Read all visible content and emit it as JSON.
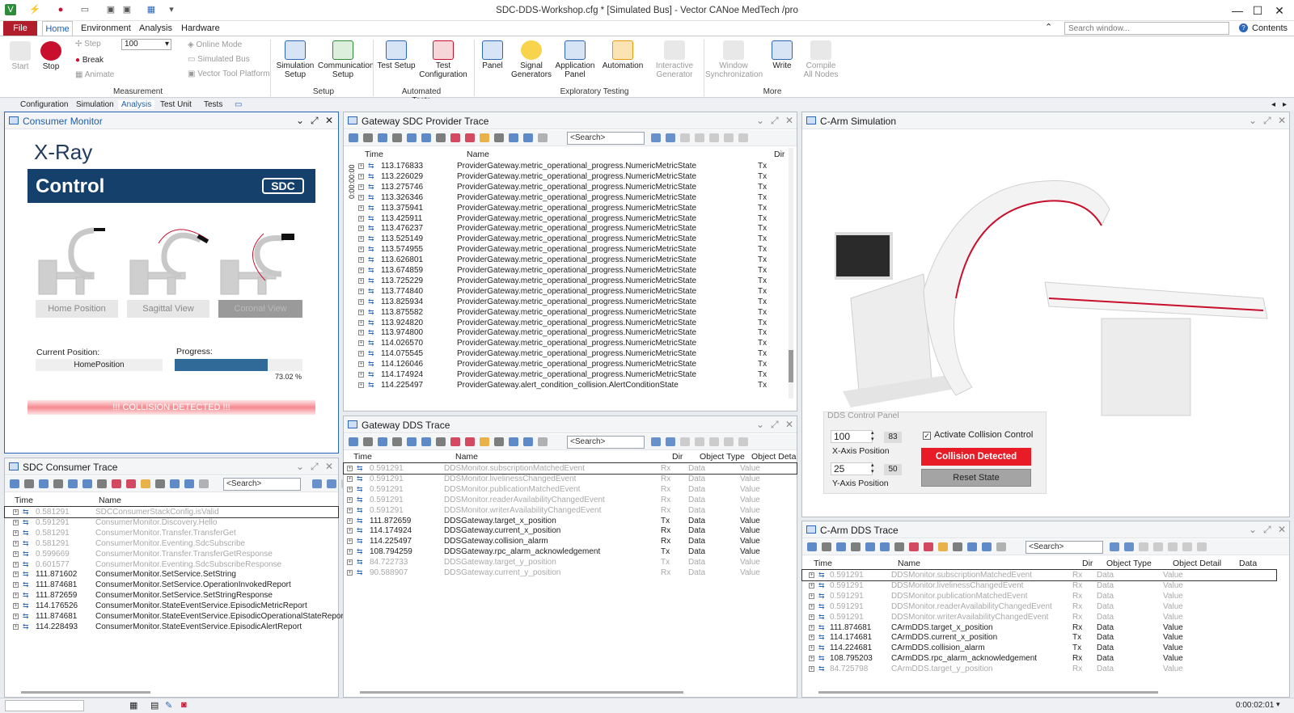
{
  "app": {
    "title": "SDC-DDS-Workshop.cfg * [Simulated Bus] - Vector CANoe MedTech /pro",
    "search_placeholder": "Search window...",
    "contents": "Contents"
  },
  "menu": [
    "File",
    "Home",
    "Environment",
    "Analysis",
    "Hardware"
  ],
  "ribbon": {
    "start": "Start",
    "stop": "Stop",
    "step": "Step",
    "break": "Break",
    "animate": "Animate",
    "step_value": "100",
    "online_mode": "Online Mode",
    "simulated_bus": "Simulated Bus",
    "vector_tool_platform": "Vector Tool Platform",
    "simulation_setup": "Simulation Setup",
    "communication_setup": "Communication Setup",
    "test_setup": "Test Setup",
    "test_configuration": "Test Configuration",
    "panel": "Panel",
    "signal_generators": "Signal Generators",
    "application_panel": "Application Panel",
    "automation": "Automation",
    "interactive_generator": "Interactive Generator",
    "window_sync": "Window Synchronization",
    "write": "Write",
    "compile": "Compile All Nodes",
    "groups": [
      "Measurement",
      "Setup",
      "Automated Tests",
      "Exploratory Testing",
      "More"
    ]
  },
  "view_tabs": [
    "Configuration",
    "Simulation",
    "Analysis",
    "Test Unit",
    "Tests"
  ],
  "consumer_monitor": {
    "title": "Consumer Monitor",
    "xray": "X-Ray",
    "control": "Control",
    "sdc": "SDC",
    "home_position": "Home Position",
    "sagittal_view": "Sagittal View",
    "coronal_view": "Coronal View",
    "current_position_label": "Current Position:",
    "current_position": "HomePosition",
    "progress_label": "Progress:",
    "progress": 0.7302,
    "progress_text": "73.02 %",
    "collision": "!!! COLLISION DETECTED !!!"
  },
  "sdc_provider_trace": {
    "title": "Gateway SDC Provider Trace",
    "search": "<Search>",
    "cols": [
      "Time",
      "Name",
      "Dir"
    ],
    "side_time": "0:00:00:00",
    "rows": [
      [
        "113.176833",
        "ProviderGateway.metric_operational_progress.NumericMetricState",
        "Tx"
      ],
      [
        "113.226029",
        "ProviderGateway.metric_operational_progress.NumericMetricState",
        "Tx"
      ],
      [
        "113.275746",
        "ProviderGateway.metric_operational_progress.NumericMetricState",
        "Tx"
      ],
      [
        "113.326346",
        "ProviderGateway.metric_operational_progress.NumericMetricState",
        "Tx"
      ],
      [
        "113.375941",
        "ProviderGateway.metric_operational_progress.NumericMetricState",
        "Tx"
      ],
      [
        "113.425911",
        "ProviderGateway.metric_operational_progress.NumericMetricState",
        "Tx"
      ],
      [
        "113.476237",
        "ProviderGateway.metric_operational_progress.NumericMetricState",
        "Tx"
      ],
      [
        "113.525149",
        "ProviderGateway.metric_operational_progress.NumericMetricState",
        "Tx"
      ],
      [
        "113.574955",
        "ProviderGateway.metric_operational_progress.NumericMetricState",
        "Tx"
      ],
      [
        "113.626801",
        "ProviderGateway.metric_operational_progress.NumericMetricState",
        "Tx"
      ],
      [
        "113.674859",
        "ProviderGateway.metric_operational_progress.NumericMetricState",
        "Tx"
      ],
      [
        "113.725229",
        "ProviderGateway.metric_operational_progress.NumericMetricState",
        "Tx"
      ],
      [
        "113.774840",
        "ProviderGateway.metric_operational_progress.NumericMetricState",
        "Tx"
      ],
      [
        "113.825934",
        "ProviderGateway.metric_operational_progress.NumericMetricState",
        "Tx"
      ],
      [
        "113.875582",
        "ProviderGateway.metric_operational_progress.NumericMetricState",
        "Tx"
      ],
      [
        "113.924820",
        "ProviderGateway.metric_operational_progress.NumericMetricState",
        "Tx"
      ],
      [
        "113.974800",
        "ProviderGateway.metric_operational_progress.NumericMetricState",
        "Tx"
      ],
      [
        "114.026570",
        "ProviderGateway.metric_operational_progress.NumericMetricState",
        "Tx"
      ],
      [
        "114.075545",
        "ProviderGateway.metric_operational_progress.NumericMetricState",
        "Tx"
      ],
      [
        "114.126046",
        "ProviderGateway.metric_operational_progress.NumericMetricState",
        "Tx"
      ],
      [
        "114.174924",
        "ProviderGateway.metric_operational_progress.NumericMetricState",
        "Tx"
      ],
      [
        "114.225497",
        "ProviderGateway.alert_condition_collision.AlertConditionState",
        "Tx"
      ]
    ]
  },
  "dds_trace": {
    "title": "Gateway DDS Trace",
    "search": "<Search>",
    "cols": [
      "Time",
      "Name",
      "Dir",
      "Object Type",
      "Object Deta"
    ],
    "rows": [
      [
        "0.591291",
        "DDSMonitor.subscriptionMatchedEvent",
        "Rx",
        "Data",
        "Value",
        true
      ],
      [
        "0.591291",
        "DDSMonitor.livelinessChangedEvent",
        "Rx",
        "Data",
        "Value",
        true
      ],
      [
        "0.591291",
        "DDSMonitor.publicationMatchedEvent",
        "Rx",
        "Data",
        "Value",
        true
      ],
      [
        "0.591291",
        "DDSMonitor.readerAvailabilityChangedEvent",
        "Rx",
        "Data",
        "Value",
        true
      ],
      [
        "0.591291",
        "DDSMonitor.writerAvailabilityChangedEvent",
        "Rx",
        "Data",
        "Value",
        true
      ],
      [
        "111.872659",
        "DDSGateway.target_x_position",
        "Tx",
        "Data",
        "Value",
        false
      ],
      [
        "114.174924",
        "DDSGateway.current_x_position",
        "Rx",
        "Data",
        "Value",
        false
      ],
      [
        "114.225497",
        "DDSGateway.collision_alarm",
        "Rx",
        "Data",
        "Value",
        false
      ],
      [
        "108.794259",
        "DDSGateway.rpc_alarm_acknowledgement",
        "Tx",
        "Data",
        "Value",
        false
      ],
      [
        "84.722733",
        "DDSGateway.target_y_position",
        "Tx",
        "Data",
        "Value",
        true
      ],
      [
        "90.588907",
        "DDSGateway.current_y_position",
        "Rx",
        "Data",
        "Value",
        true
      ]
    ]
  },
  "sdc_consumer_trace": {
    "title": "SDC Consumer Trace",
    "search": "<Search>",
    "cols": [
      "Time",
      "Name"
    ],
    "rows": [
      [
        "0.581291",
        "SDCConsumerStackConfig.isValid",
        true
      ],
      [
        "0.591291",
        "ConsumerMonitor.Discovery.Hello",
        true
      ],
      [
        "0.581291",
        "ConsumerMonitor.Transfer.TransferGet",
        true
      ],
      [
        "0.581291",
        "ConsumerMonitor.Eventing.SdcSubscribe",
        true
      ],
      [
        "0.599669",
        "ConsumerMonitor.Transfer.TransferGetResponse",
        true
      ],
      [
        "0.601577",
        "ConsumerMonitor.Eventing.SdcSubscribeResponse",
        true
      ],
      [
        "111.871602",
        "ConsumerMonitor.SetService.SetString",
        false
      ],
      [
        "111.874681",
        "ConsumerMonitor.SetService.OperationInvokedReport",
        false
      ],
      [
        "111.872659",
        "ConsumerMonitor.SetService.SetStringResponse",
        false
      ],
      [
        "114.176526",
        "ConsumerMonitor.StateEventService.EpisodicMetricReport",
        false
      ],
      [
        "111.874681",
        "ConsumerMonitor.StateEventService.EpisodicOperationalStateReport",
        false
      ],
      [
        "114.228493",
        "ConsumerMonitor.StateEventService.EpisodicAlertReport",
        false
      ]
    ]
  },
  "carm_sim": {
    "title": "C-Arm Simulation",
    "panel_title": "DDS Control Panel",
    "x_value": "100",
    "x_actual": "83",
    "x_label": "X-Axis Position",
    "y_value": "25",
    "y_actual": "50",
    "y_label": "Y-Axis Position",
    "activate": "Activate Collision Control",
    "collision_btn": "Collision Detected",
    "reset_btn": "Reset State"
  },
  "carm_dds": {
    "title": "C-Arm DDS Trace",
    "search": "<Search>",
    "cols": [
      "Time",
      "Name",
      "Dir",
      "Object Type",
      "Object Detail",
      "Data"
    ],
    "rows": [
      [
        "0.591291",
        "DDSMonitor.subscriptionMatchedEvent",
        "Rx",
        "Data",
        "Value",
        true
      ],
      [
        "0.591291",
        "DDSMonitor.livelinessChangedEvent",
        "Rx",
        "Data",
        "Value",
        true
      ],
      [
        "0.591291",
        "DDSMonitor.publicationMatchedEvent",
        "Rx",
        "Data",
        "Value",
        true
      ],
      [
        "0.591291",
        "DDSMonitor.readerAvailabilityChangedEvent",
        "Rx",
        "Data",
        "Value",
        true
      ],
      [
        "0.591291",
        "DDSMonitor.writerAvailabilityChangedEvent",
        "Rx",
        "Data",
        "Value",
        true
      ],
      [
        "111.874681",
        "CArmDDS.target_x_position",
        "Rx",
        "Data",
        "Value",
        false
      ],
      [
        "114.174681",
        "CArmDDS.current_x_position",
        "Tx",
        "Data",
        "Value",
        false
      ],
      [
        "114.224681",
        "CArmDDS.collision_alarm",
        "Tx",
        "Data",
        "Value",
        false
      ],
      [
        "108.795203",
        "CArmDDS.rpc_alarm_acknowledgement",
        "Rx",
        "Data",
        "Value",
        false
      ],
      [
        "84.725798",
        "CArmDDS.target_y_position",
        "Rx",
        "Data",
        "Value",
        true
      ]
    ]
  },
  "status": {
    "time": "0:00:02:01"
  }
}
